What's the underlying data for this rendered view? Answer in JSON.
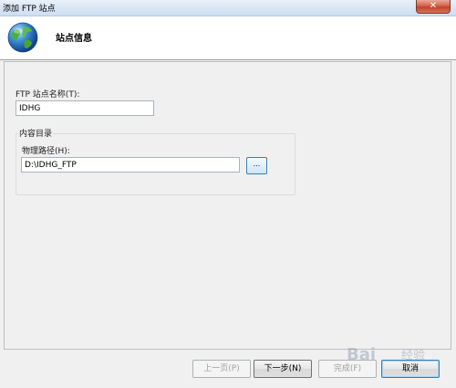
{
  "window": {
    "title": "添加 FTP 站点",
    "close_glyph": "✕"
  },
  "header": {
    "title": "站点信息",
    "icon": "globe-icon"
  },
  "form": {
    "site_name_label": "FTP 站点名称(T):",
    "site_name_value": "IDHG",
    "content_dir_group": "内容目录",
    "physical_path_label": "物理路径(H):",
    "physical_path_value": "D:\\IDHG_FTP",
    "browse_label": "..."
  },
  "buttons": {
    "previous": "上一页(P)",
    "next": "下一步(N)",
    "finish": "完成(F)",
    "cancel": "取消"
  },
  "watermark": {
    "text": "Bai",
    "suffix": "经验"
  },
  "colors": {
    "titlebar": "#d6e4f3",
    "close": "#c2432a",
    "accent_border": "#3c7fb1"
  }
}
